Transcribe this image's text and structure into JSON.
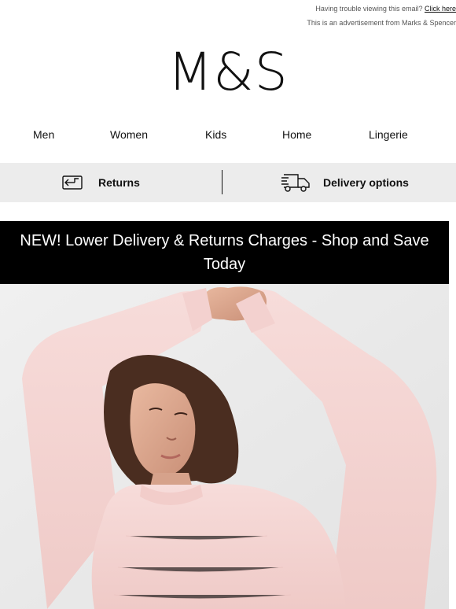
{
  "header": {
    "trouble_text": "Having trouble viewing this email?",
    "click_here": "Click here",
    "ad_text": "This is an advertisement from Marks & Spencer"
  },
  "logo": {
    "text": "M&S"
  },
  "nav": {
    "items": [
      {
        "label": "Men"
      },
      {
        "label": "Women"
      },
      {
        "label": "Kids"
      },
      {
        "label": "Home"
      },
      {
        "label": "Lingerie"
      }
    ]
  },
  "utility": {
    "returns_label": "Returns",
    "returns_icon": "returns-icon",
    "delivery_label": "Delivery options",
    "delivery_icon": "delivery-truck-icon",
    "background": "#ececec"
  },
  "banner": {
    "text": "NEW! Lower Delivery & Returns Charges - Shop and Save Today",
    "background": "#000000",
    "color": "#ffffff"
  },
  "hero": {
    "subject": "model-in-pink-sweater",
    "sweater_color": "#f5d3d0",
    "background": "#ebebeb"
  }
}
